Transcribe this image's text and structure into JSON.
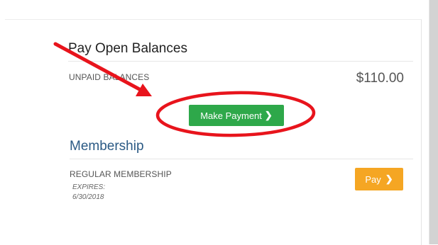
{
  "pay_open_balances": {
    "title": "Pay Open Balances",
    "unpaid_label": "UNPAID BALANCES",
    "amount": "$110.00",
    "button_label": "Make Payment"
  },
  "membership": {
    "title": "Membership",
    "type_label": "REGULAR MEMBERSHIP",
    "expires_label": "EXPIRES:",
    "expires_date": "6/30/2018",
    "button_label": "Pay"
  },
  "icons": {
    "button_chevron": "chevron-right-icon"
  },
  "colors": {
    "primary_button": "#2ea84a",
    "pay_button": "#f5a623",
    "section_heading": "#2b5a85",
    "annotation": "#e8141c"
  }
}
